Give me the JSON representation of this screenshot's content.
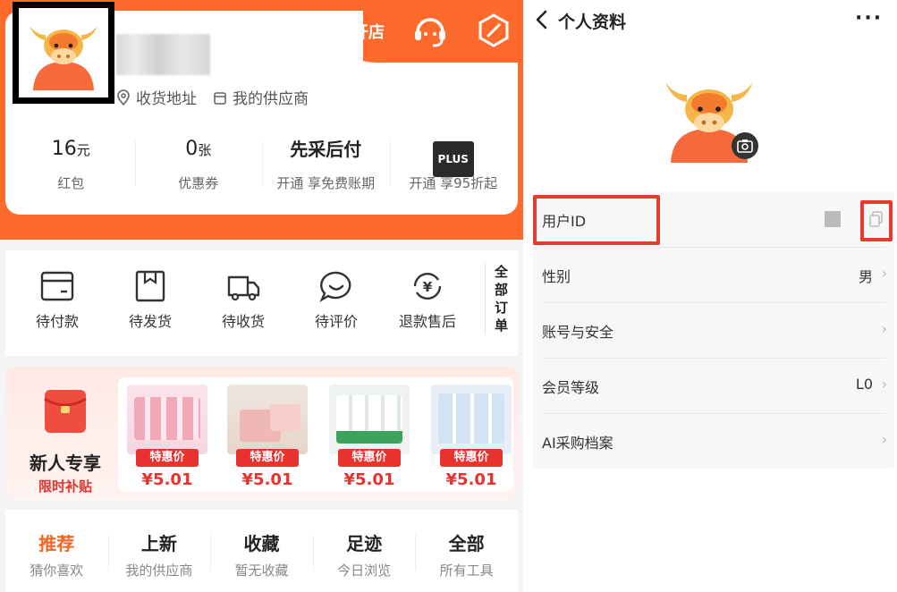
{
  "left": {
    "header": {
      "open_shop": "开店",
      "address_label": "收货地址",
      "suppliers_label": "我的供应商"
    },
    "stats": [
      {
        "value": "16",
        "unit": "元",
        "label": "红包"
      },
      {
        "value": "0",
        "unit": "张",
        "label": "优惠券"
      },
      {
        "value": "先采后付",
        "unit": "",
        "label": "开通 享免费账期"
      },
      {
        "value": "PLUS",
        "unit": "",
        "label": "开通 享95折起"
      }
    ],
    "orders": [
      {
        "icon": "wallet-icon",
        "label": "待付款"
      },
      {
        "icon": "package-icon",
        "label": "待发货"
      },
      {
        "icon": "truck-icon",
        "label": "待收货"
      },
      {
        "icon": "chat-bubble-icon",
        "label": "待评价"
      },
      {
        "icon": "refund-yen-icon",
        "label": "退款售后"
      }
    ],
    "all_orders": "全部订单",
    "promo": {
      "title": "新人专享",
      "subtitle": "限时补贴",
      "products": [
        {
          "tag": "特惠价",
          "price": "¥5.01"
        },
        {
          "tag": "特惠价",
          "price": "¥5.01"
        },
        {
          "tag": "特惠价",
          "price": "¥5.01"
        },
        {
          "tag": "特惠价",
          "price": "¥5.01"
        }
      ]
    },
    "tabs": [
      {
        "title": "推荐",
        "sub": "猜你喜欢"
      },
      {
        "title": "上新",
        "sub": "我的供应商"
      },
      {
        "title": "收藏",
        "sub": "暂无收藏"
      },
      {
        "title": "足迹",
        "sub": "今日浏览"
      },
      {
        "title": "全部",
        "sub": "所有工具"
      }
    ],
    "colors": {
      "brand": "#fe6a2b",
      "accent_red": "#e8322d",
      "active_tab": "#f26722"
    }
  },
  "right": {
    "title": "个人资料",
    "more": "···",
    "rows": [
      {
        "label": "用户ID",
        "value": ""
      },
      {
        "label": "性别",
        "value": "男"
      },
      {
        "label": "账号与安全",
        "value": ""
      },
      {
        "label": "会员等级",
        "value": "L0"
      },
      {
        "label": "AI采购档案",
        "value": ""
      }
    ],
    "highlight_color": "#e53b2e"
  }
}
